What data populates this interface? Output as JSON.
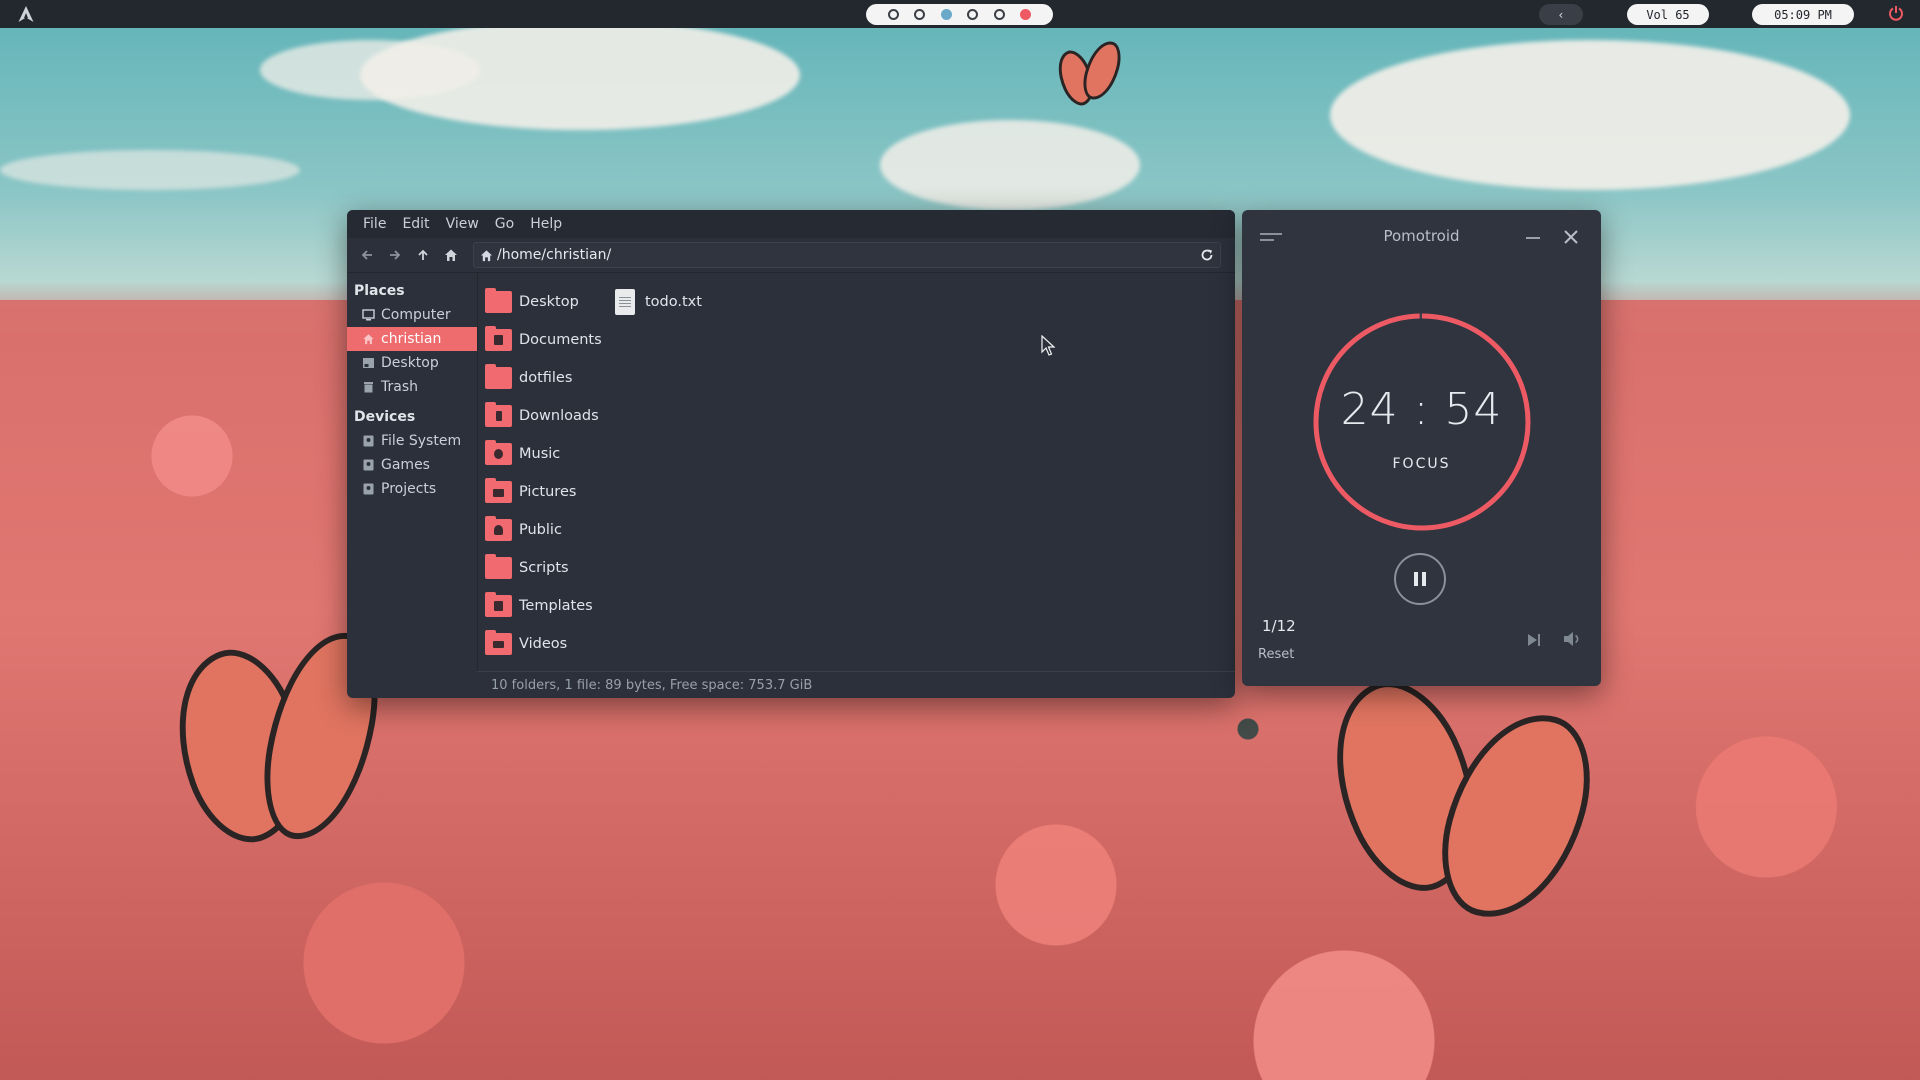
{
  "topbar": {
    "logo_icon": "arch-logo-icon",
    "workspaces": [
      {
        "state": "empty"
      },
      {
        "state": "empty"
      },
      {
        "state": "active"
      },
      {
        "state": "empty"
      },
      {
        "state": "empty"
      },
      {
        "state": "urgent"
      }
    ],
    "back_label": "‹",
    "volume": "Vol 65",
    "clock": "05:09 PM",
    "power_icon": "power-icon"
  },
  "file_manager": {
    "menu": [
      "File",
      "Edit",
      "View",
      "Go",
      "Help"
    ],
    "toolbar_icons": [
      "back-icon",
      "forward-icon",
      "up-icon",
      "home-icon"
    ],
    "location": "/home/christian/",
    "sidebar": {
      "places_heading": "Places",
      "places": [
        {
          "label": "Computer",
          "icon": "computer-icon"
        },
        {
          "label": "christian",
          "icon": "home-icon",
          "selected": true
        },
        {
          "label": "Desktop",
          "icon": "desktop-icon"
        },
        {
          "label": "Trash",
          "icon": "trash-icon"
        }
      ],
      "devices_heading": "Devices",
      "devices": [
        {
          "label": "File System",
          "icon": "drive-icon"
        },
        {
          "label": "Games",
          "icon": "drive-icon"
        },
        {
          "label": "Projects",
          "icon": "drive-icon"
        }
      ]
    },
    "folders": [
      "Desktop",
      "Documents",
      "dotfiles",
      "Downloads",
      "Music",
      "Pictures",
      "Public",
      "Scripts",
      "Templates",
      "Videos"
    ],
    "files": [
      "todo.txt"
    ],
    "status": "10 folders, 1 file: 89 bytes, Free space: 753.7 GiB"
  },
  "pomotroid": {
    "title": "Pomotroid",
    "time": "24 : 54",
    "mode": "FOCUS",
    "round": "1/12",
    "reset": "Reset",
    "progress_fraction": 0.996,
    "accent": "#ee5a64"
  },
  "colors": {
    "accent": "#ee6b6e",
    "panel": "#2b303b",
    "topbar": "#23272e"
  }
}
